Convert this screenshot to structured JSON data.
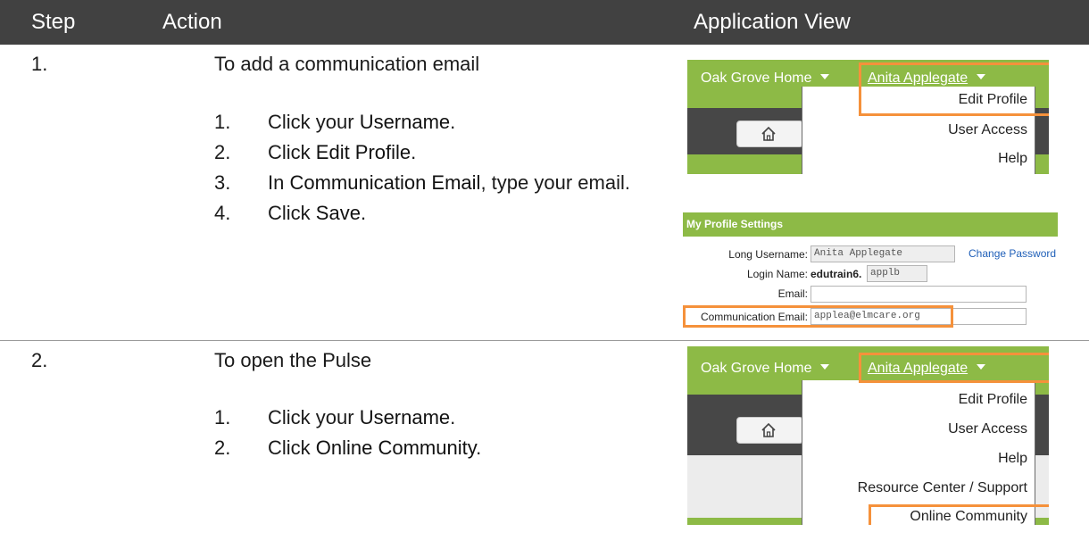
{
  "header": {
    "step": "Step",
    "action": "Action",
    "view": "Application View"
  },
  "steps": [
    {
      "number": "1.",
      "title": "To add a communication email",
      "items": [
        {
          "num": "1.",
          "pre": "Click your ",
          "bold": "Username",
          "post": "."
        },
        {
          "num": "2.",
          "pre": "Click ",
          "bold": "Edit Profile",
          "post": "."
        },
        {
          "num": "3.",
          "pre": "In ",
          "bold": "Communication Email",
          "post": ", type your email."
        },
        {
          "num": "4.",
          "pre": "Click ",
          "bold": "Save",
          "post": "."
        }
      ]
    },
    {
      "number": "2.",
      "title": "To open the Pulse",
      "items": [
        {
          "num": "1.",
          "pre": "Click your ",
          "bold": "Username",
          "post": "."
        },
        {
          "num": "2.",
          "pre": "Click ",
          "bold": "Online Community",
          "post": "."
        }
      ]
    }
  ],
  "app1": {
    "home_label": "Oak Grove Home",
    "username": "Anita Applegate",
    "menu": [
      "Edit Profile",
      "User Access",
      "Help"
    ]
  },
  "profile": {
    "title": "My Profile Settings",
    "long_username_label": "Long Username:",
    "long_username_value": "Anita Applegate",
    "change_password": "Change Password",
    "login_label": "Login Name:",
    "login_prefix": "edutrain6.",
    "login_value": "applb",
    "email_label": "Email:",
    "email_value": "",
    "comm_label": "Communication Email:",
    "comm_value": "applea@elmcare.org"
  },
  "app2": {
    "home_label": "Oak Grove Home",
    "username": "Anita Applegate",
    "menu": [
      "Edit Profile",
      "User Access",
      "Help",
      "Resource Center / Support",
      "Online Community"
    ]
  },
  "colors": {
    "header_bg": "#414141",
    "app_green": "#8dba46",
    "highlight": "#f5913b",
    "link": "#1f5fb8"
  },
  "icons": [
    "home-icon",
    "caret-down-icon"
  ]
}
